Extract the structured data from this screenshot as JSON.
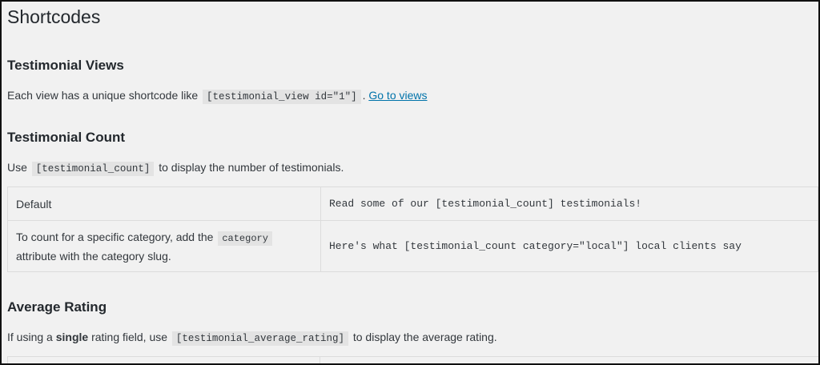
{
  "page": {
    "title": "Shortcodes"
  },
  "views": {
    "heading": "Testimonial Views",
    "text_before": "Each view has a unique shortcode like",
    "code": "[testimonial_view id=\"1\"]",
    "text_after": ".",
    "link": "Go to views"
  },
  "count": {
    "heading": "Testimonial Count",
    "text_before": "Use",
    "code": "[testimonial_count]",
    "text_after": "to display the number of testimonials.",
    "table": {
      "row1": {
        "label": "Default",
        "example": "Read some of our [testimonial_count] testimonials!"
      },
      "row2": {
        "label_before": "To count for a specific category, add the",
        "label_code": "category",
        "label_after": "attribute with the category slug.",
        "example": "Here's what [testimonial_count category=\"local\"] local clients say"
      }
    }
  },
  "rating": {
    "heading": "Average Rating",
    "text_before": "If using a",
    "text_bold": "single",
    "text_mid": "rating field, use",
    "code": "[testimonial_average_rating]",
    "text_after": "to display the average rating."
  }
}
